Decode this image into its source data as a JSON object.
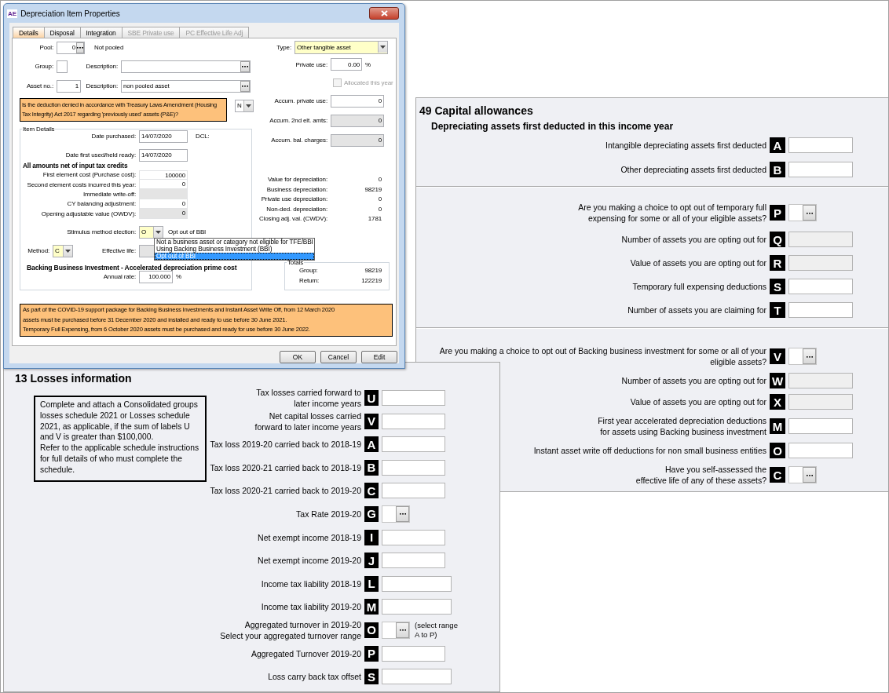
{
  "dialog": {
    "app_badge": "AE",
    "title": "Depreciation Item Properties",
    "tabs": [
      {
        "label": "Details",
        "selected": true,
        "disabled": false
      },
      {
        "label": "Disposal",
        "selected": false,
        "disabled": false
      },
      {
        "label": "Integration",
        "selected": false,
        "disabled": false
      },
      {
        "label": "SBE Private use",
        "selected": false,
        "disabled": true
      },
      {
        "label": "PC Effective Life Adj",
        "selected": false,
        "disabled": true
      }
    ],
    "pool": {
      "label": "Pool:",
      "value": "0",
      "status": "Not pooled"
    },
    "group": {
      "label": "Group:",
      "description_label": "Description:"
    },
    "asset": {
      "label": "Asset no.:",
      "value": "1",
      "description_label": "Description:",
      "description": "non pooled asset"
    },
    "question": {
      "text": "Is the deduction denied in accordance with Treasury Laws Amendment (Housing Tax Integrity) Act 2017 regarding 'previously used' assets (P&E)?",
      "value": "N"
    },
    "type": {
      "label": "Type:",
      "value": "Other tangible asset"
    },
    "private_use": {
      "label": "Private use:",
      "value": "0.00",
      "unit": "%"
    },
    "allocated": {
      "label": "Allocated this year",
      "checked": false,
      "disabled": true
    },
    "accumulated": [
      {
        "label": "Accum. private use:",
        "value": "0",
        "disabled": false
      },
      {
        "label": "Accum. 2nd elt. amts:",
        "value": "0",
        "disabled": true
      },
      {
        "label": "Accum. bal. charges:",
        "value": "0",
        "disabled": true
      }
    ],
    "item_details": {
      "legend": "Item Details",
      "dates": [
        {
          "label": "Date purchased:",
          "value": "14/07/2020",
          "note": "DCL:"
        },
        {
          "label": "Date first used/held ready:",
          "value": "14/07/2020"
        }
      ],
      "amounts_heading": "All amounts net of input tax credits",
      "amounts": [
        {
          "label": "First element cost (Purchase cost):",
          "value": "100000",
          "disabled": false
        },
        {
          "label": "Second element costs incurred this year:",
          "value": "0",
          "disabled": false
        },
        {
          "label": "Immediate write-off:",
          "disabled": true
        },
        {
          "label": "CY balancing adjustment:",
          "value": "0",
          "disabled": false
        },
        {
          "label": "Opening adjustable value (OWDV):",
          "value": "0",
          "disabled": true
        }
      ],
      "stimulus": {
        "label": "Stimulus method election:",
        "value": "O",
        "description": "Opt out of BBI",
        "expanded": true,
        "options": [
          {
            "label": "Not a business asset or category not eligible for TFE/BBI",
            "selected": false
          },
          {
            "label": "Using Backing Business Investment (BBI)",
            "selected": false
          },
          {
            "label": "Opt out of BBI",
            "selected": true
          }
        ]
      },
      "method": {
        "label": "Method:",
        "value": "C"
      },
      "effective_life": {
        "label": "Effective life:"
      },
      "bbi_heading": "Backing Business Investment - Accelerated depreciation prime cost",
      "annual_rate": {
        "label": "Annual rate:",
        "value": "100.000",
        "unit": "%"
      }
    },
    "depreciation": [
      {
        "label": "Value for depreciation:",
        "value": "0"
      },
      {
        "label": "Business depreciation:",
        "value": "98219"
      },
      {
        "label": "Private use depreciation:",
        "value": "0"
      },
      {
        "label": "Non-ded. depreciation:",
        "value": "0"
      },
      {
        "label": "Closing adj. val. (CWDV):",
        "value": "1781"
      }
    ],
    "totals": {
      "legend": "Totals",
      "rows": [
        {
          "label": "Group:",
          "value": "98219"
        },
        {
          "label": "Return:",
          "value": "122219"
        }
      ]
    },
    "notice": [
      "As part of the COVID-19 support package for Backing Business Investments and Instant Asset Write Off, from 12 March 2020",
      "assets must be purchased before 31 December 2020 and installed and ready to use before 30 June 2021.",
      "Temporary Full Expensing, from 6 October 2020 assets must be purchased and ready for use before 30 June 2022."
    ],
    "buttons": [
      "OK",
      "Cancel",
      "Edit"
    ]
  },
  "capital_allowances": {
    "title": "49 Capital allowances",
    "subtitle": "Depreciating assets first deducted in this income year",
    "sections": [
      {
        "rows": [
          {
            "label": [
              "Intangible depreciating assets first deducted"
            ],
            "code": "A",
            "kind": "text"
          },
          {
            "label": [
              "Other depreciating assets first deducted"
            ],
            "code": "B",
            "kind": "text"
          }
        ]
      },
      {
        "rows": [
          {
            "label": [
              "Are you making a choice to opt out of temporary full",
              "expensing for some or all of your eligible assets?"
            ],
            "code": "P",
            "kind": "lookup"
          },
          {
            "label": [
              "Number of assets you are opting out for"
            ],
            "code": "Q",
            "kind": "readonly"
          },
          {
            "label": [
              "Value of assets you are opting out for"
            ],
            "code": "R",
            "kind": "readonly"
          },
          {
            "label": [
              "Temporary full expensing deductions"
            ],
            "code": "S",
            "kind": "text"
          },
          {
            "label": [
              "Number of assets you are claiming for"
            ],
            "code": "T",
            "kind": "text"
          }
        ]
      },
      {
        "rows": [
          {
            "label": [
              "Are you making a choice to opt out of Backing business investment for some or all of your",
              "eligible assets?"
            ],
            "code": "V",
            "kind": "lookup"
          },
          {
            "label": [
              "Number of assets you are opting out for"
            ],
            "code": "W",
            "kind": "readonly"
          },
          {
            "label": [
              "Value of assets you are opting out for"
            ],
            "code": "X",
            "kind": "readonly"
          },
          {
            "label": [
              "First year accelerated depreciation deductions",
              "for assets using Backing business investment"
            ],
            "code": "M",
            "kind": "text"
          },
          {
            "label": [
              "Instant asset write off deductions for non small business entities"
            ],
            "code": "O",
            "kind": "text"
          },
          {
            "label": [
              "Have you self-assessed the",
              "effective life of any of these assets?"
            ],
            "code": "C",
            "kind": "lookup"
          }
        ]
      }
    ]
  },
  "losses": {
    "title": "13 Losses information",
    "note": [
      "Complete and attach a Consolidated groups losses schedule 2021 or Losses schedule 2021, as applicable, if the sum of labels U and V is greater than $100,000.",
      "Refer to the applicable schedule instructions for full details of who must complete the schedule."
    ],
    "rows": [
      {
        "label": [
          "Tax losses carried forward to",
          "later income years"
        ],
        "code": "U",
        "kind": "text"
      },
      {
        "label": [
          "Net capital losses carried",
          "forward to later income years"
        ],
        "code": "V",
        "kind": "text"
      },
      {
        "label": [
          "Tax loss 2019-20 carried back to 2018-19"
        ],
        "code": "A",
        "kind": "text"
      },
      {
        "label": [
          "Tax loss 2020-21 carried back to 2018-19"
        ],
        "code": "B",
        "kind": "text"
      },
      {
        "label": [
          "Tax loss 2020-21 carried back to 2019-20"
        ],
        "code": "C",
        "kind": "text"
      },
      {
        "label": [
          "Tax Rate 2019-20"
        ],
        "code": "G",
        "kind": "lookup"
      },
      {
        "label": [
          "Net exempt income 2018-19"
        ],
        "code": "I",
        "kind": "text"
      },
      {
        "label": [
          "Net exempt income 2019-20"
        ],
        "code": "J",
        "kind": "text"
      },
      {
        "label": [
          "Income tax liability 2018-19"
        ],
        "code": "L",
        "kind": "wide"
      },
      {
        "label": [
          "Income tax liability 2019-20"
        ],
        "code": "M",
        "kind": "wide"
      },
      {
        "label": [
          "Aggregated turnover in 2019-20",
          "Select your aggregated turnover range"
        ],
        "code": "O",
        "kind": "lookup",
        "hint": [
          "(select range",
          "A to P)"
        ]
      },
      {
        "label": [
          "Aggregated Turnover 2019-20"
        ],
        "code": "P",
        "kind": "text"
      },
      {
        "label": [
          "Loss carry back tax offset"
        ],
        "code": "S",
        "kind": "wide"
      }
    ]
  }
}
